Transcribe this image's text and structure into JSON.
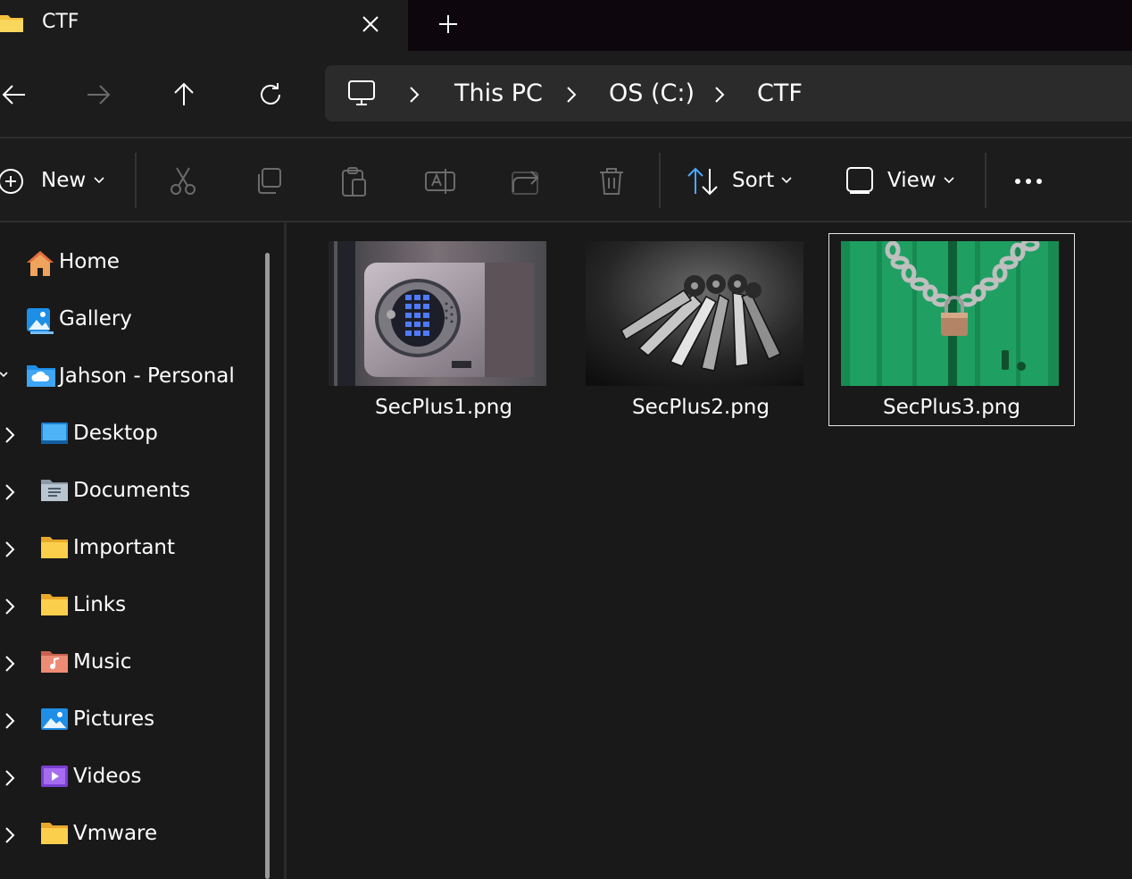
{
  "window": {
    "tab_title": "CTF",
    "tab_close_icon": "close-icon",
    "new_tab_icon": "plus-icon"
  },
  "nav": {
    "back_icon": "arrow-left-icon",
    "forward_icon": "arrow-right-icon",
    "up_icon": "arrow-up-icon",
    "refresh_icon": "refresh-icon",
    "computer_icon": "monitor-icon",
    "breadcrumb": [
      "This PC",
      "OS (C:)",
      "CTF"
    ]
  },
  "toolbar": {
    "new_label": "New",
    "sort_label": "Sort",
    "view_label": "View",
    "icons": [
      "cut-icon",
      "copy-icon",
      "paste-icon",
      "rename-icon",
      "share-icon",
      "delete-icon",
      "more-icon"
    ]
  },
  "sidebar": {
    "items": [
      {
        "label": "Home",
        "icon": "home-icon"
      },
      {
        "label": "Gallery",
        "icon": "gallery-icon"
      },
      {
        "label": "Jahson - Personal",
        "icon": "onedrive-folder-icon"
      },
      {
        "label": "Desktop",
        "icon": "desktop-folder-icon"
      },
      {
        "label": "Documents",
        "icon": "documents-folder-icon"
      },
      {
        "label": "Important",
        "icon": "folder-icon"
      },
      {
        "label": "Links",
        "icon": "folder-icon"
      },
      {
        "label": "Music",
        "icon": "music-folder-icon"
      },
      {
        "label": "Pictures",
        "icon": "pictures-folder-icon"
      },
      {
        "label": "Videos",
        "icon": "videos-folder-icon"
      },
      {
        "label": "Vmware",
        "icon": "folder-icon"
      }
    ]
  },
  "files": [
    {
      "name": "SecPlus1.png",
      "thumbnail": "keypad-safe-photo",
      "selected": false
    },
    {
      "name": "SecPlus2.png",
      "thumbnail": "keys-photo",
      "selected": false
    },
    {
      "name": "SecPlus3.png",
      "thumbnail": "padlock-chain-green-door-photo",
      "selected": true
    }
  ],
  "colors": {
    "accent_folder": "#f3c13a",
    "selection_border": "#e6e6e6",
    "background": "#191919"
  }
}
